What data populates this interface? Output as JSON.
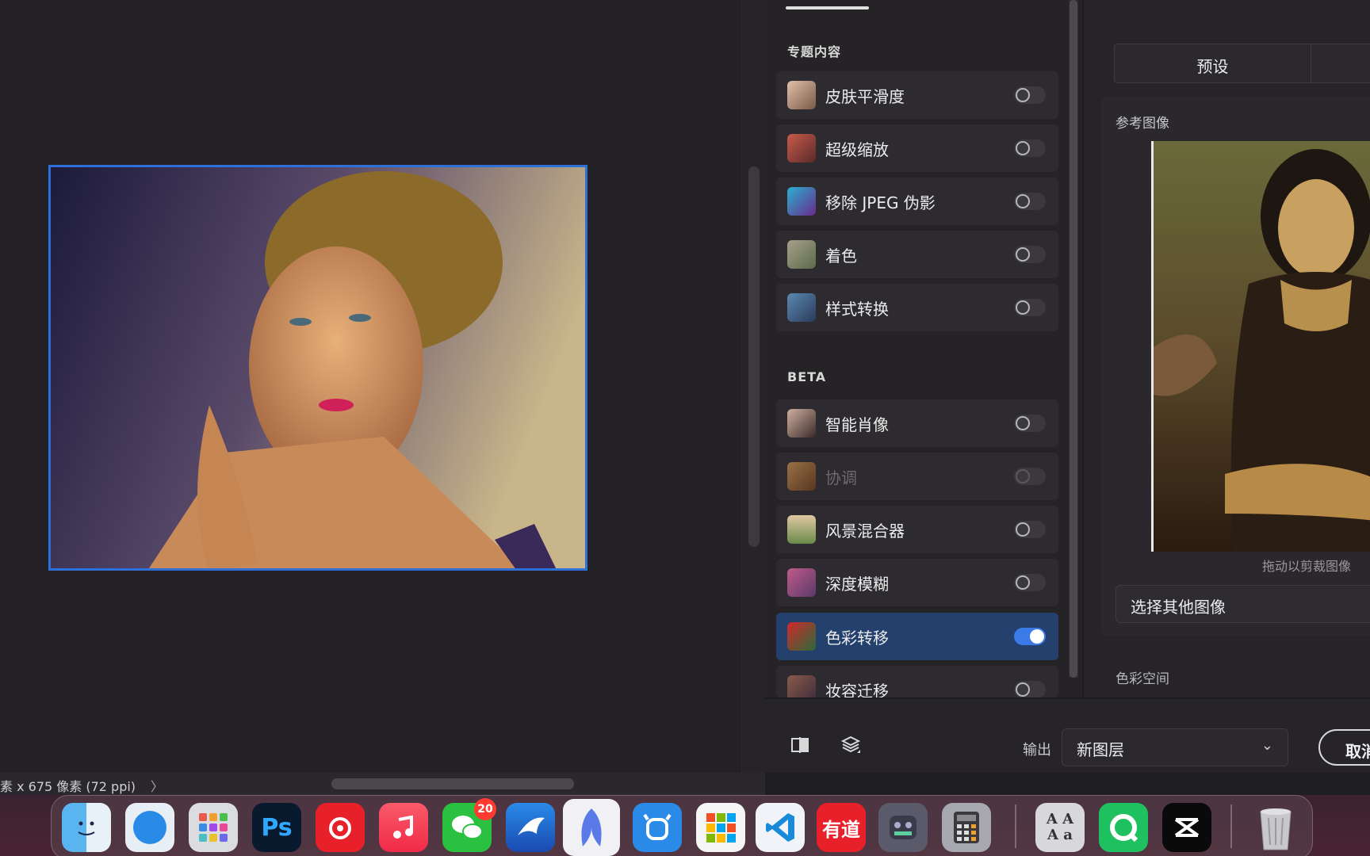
{
  "status": {
    "doc_info": "素 x 675 像素 (72 ppi)",
    "chevron": "〉"
  },
  "panel": {
    "section_featured": "专题内容",
    "featured": [
      {
        "label": "皮肤平滑度",
        "on": false,
        "icon": "skin-smoothing-icon"
      },
      {
        "label": "超级缩放",
        "on": false,
        "icon": "super-zoom-icon"
      },
      {
        "label": "移除 JPEG 伪影",
        "on": false,
        "icon": "jpeg-artifacts-icon"
      },
      {
        "label": "着色",
        "on": false,
        "icon": "colorize-icon"
      },
      {
        "label": "样式转换",
        "on": false,
        "icon": "style-transfer-icon"
      }
    ],
    "section_beta": "BETA",
    "beta": [
      {
        "label": "智能肖像",
        "on": false,
        "icon": "smart-portrait-icon"
      },
      {
        "label": "协调",
        "on": false,
        "disabled": true,
        "icon": "harmonization-icon"
      },
      {
        "label": "风景混合器",
        "on": false,
        "icon": "landscape-mixer-icon"
      },
      {
        "label": "深度模糊",
        "on": false,
        "icon": "depth-blur-icon"
      },
      {
        "label": "色彩转移",
        "on": true,
        "icon": "color-transfer-icon"
      },
      {
        "label": "妆容迁移",
        "on": false,
        "icon": "makeup-transfer-icon"
      }
    ]
  },
  "right": {
    "tab_preset": "预设",
    "ref_title": "参考图像",
    "ref_hint": "拖动以剪裁图像",
    "choose_button": "选择其他图像",
    "color_space_label": "色彩空间"
  },
  "bottom": {
    "output_label": "输出",
    "output_value": "新图层",
    "cancel_label": "取消"
  },
  "dock": {
    "wechat_badge": "20",
    "ps_label": "Ps",
    "youdao_label": "有道",
    "font_label": "A A\nA a"
  },
  "colors": {
    "accent": "#3a7be8",
    "active_item": "#24406c",
    "selection_frame": "#2f6fd8"
  }
}
